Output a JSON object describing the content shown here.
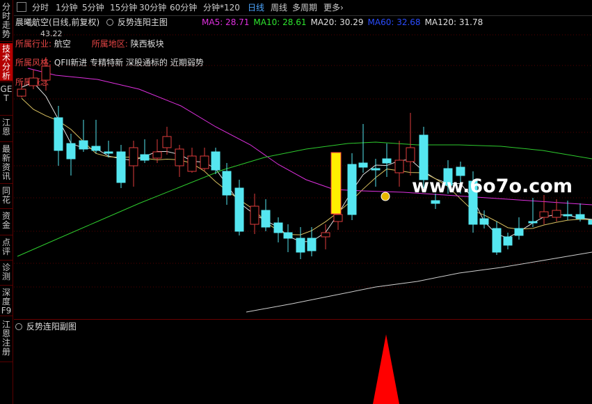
{
  "sidebar": {
    "tabs": [
      {
        "label": "分时走势",
        "active": false
      },
      {
        "label": "技术分析",
        "active": true
      },
      {
        "label": "GET",
        "active": false
      },
      {
        "label": "江恩",
        "active": false
      },
      {
        "label": "最新资讯",
        "active": false
      },
      {
        "label": "同花",
        "active": false
      },
      {
        "label": "资金",
        "active": false
      },
      {
        "label": "点评",
        "active": false
      },
      {
        "label": "诊测",
        "active": false
      },
      {
        "label": "深度F9",
        "active": false
      },
      {
        "label": "江恩注册",
        "active": false
      }
    ]
  },
  "toolbar": {
    "periods": [
      "分时",
      "1分钟",
      "5分钟",
      "15分钟",
      "30分钟",
      "60分钟",
      "分钟*120",
      "日线",
      "周线",
      "多周期",
      "更多›"
    ],
    "active_period": "日线"
  },
  "stock": {
    "title": "晨曦航空(日线,前复权)",
    "indicator": "反势连阳主图",
    "high_marker": "43.22"
  },
  "ma": [
    {
      "label": "MA5: 28.71",
      "color": "#e030e0"
    },
    {
      "label": "MA10: 28.61",
      "color": "#2ee62e"
    },
    {
      "label": "MA20: 30.29",
      "color": "#e0e0e0"
    },
    {
      "label": "MA60: 32.68",
      "color": "#2a4cff"
    },
    {
      "label": "MA120: 31.78",
      "color": "#e0e0e0"
    }
  ],
  "info": {
    "industry_label": "所属行业:",
    "industry": "航空",
    "region_label": "所属地区:",
    "region": "陕西板块",
    "style_label": "所属风格:",
    "style": "QFII新进 专精特新 深股通标的 近期弱势",
    "concept_label": "所属概念"
  },
  "sub": {
    "title": "反势连阳副图"
  },
  "watermark": "www.6o7o.com",
  "colors": {
    "up": "#e03c3c",
    "down": "#55e6f0",
    "highlight": "#ffee00",
    "arrow": "#ff0000"
  }
}
